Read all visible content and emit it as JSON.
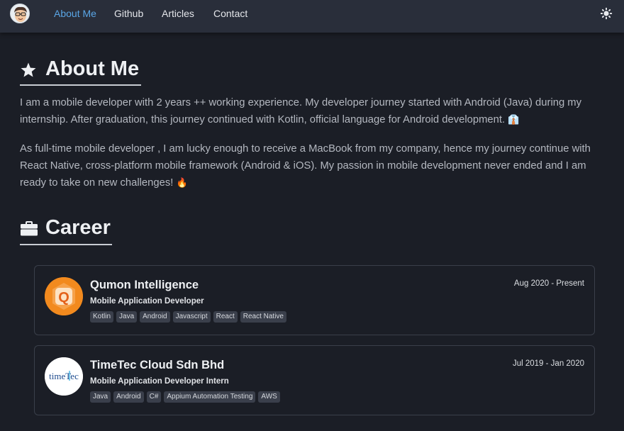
{
  "nav": {
    "links": [
      "About Me",
      "Github",
      "Articles",
      "Contact"
    ],
    "active": "About Me",
    "avatar_icon": "memoji-avatar-icon",
    "theme_icon": "sun-icon"
  },
  "about": {
    "title": "About Me",
    "icon": "star-icon",
    "paragraph1": "I am a mobile developer with 2 years ++ working experience. My developer journey started with Android (Java) during my internship. After graduation, this journey continued with Kotlin, official language for Android development.",
    "paragraph1_emoji": "👔",
    "paragraph2": "As full-time mobile developer , I am lucky enough to receive a MacBook from my company, hence my journey continue with React Native, cross-platform mobile framework (Android & iOS). My passion in mobile development never ended and I am ready to take on new challenges!",
    "paragraph2_emoji": "🔥"
  },
  "career": {
    "title": "Career",
    "icon": "briefcase-icon",
    "jobs": [
      {
        "company": "Qumon Intelligence",
        "role": "Mobile Application Developer",
        "dates": "Aug 2020 - Present",
        "tags": [
          "Kotlin",
          "Java",
          "Android",
          "Javascript",
          "React",
          "React Native"
        ],
        "logo_icon": "qumon-logo-icon",
        "logo_letter": "Q"
      },
      {
        "company": "TimeTec Cloud Sdn Bhd",
        "role": "Mobile Application Developer Intern",
        "dates": "Jul 2019 - Jan 2020",
        "tags": [
          "Java",
          "Android",
          "C#",
          "Appium Automation Testing",
          "AWS"
        ],
        "logo_icon": "timetec-logo-icon",
        "logo_text": "timeTec"
      }
    ]
  },
  "colors": {
    "background": "#1b1e26",
    "navbar": "#292e3a",
    "active_link": "#5aa6e6",
    "qumon_orange": "#f28a1e"
  }
}
